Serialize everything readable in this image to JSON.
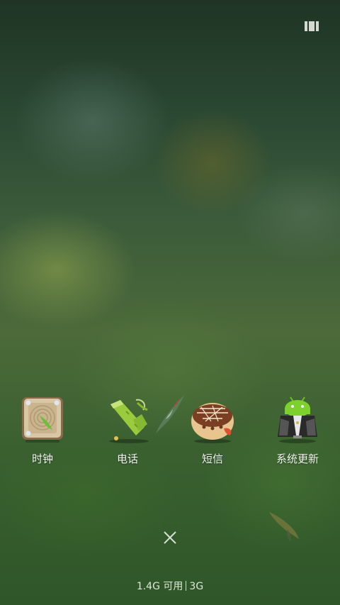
{
  "apps": [
    {
      "label": "时钟",
      "icon": "clock-icon"
    },
    {
      "label": "电话",
      "icon": "phone-icon"
    },
    {
      "label": "短信",
      "icon": "messages-icon"
    },
    {
      "label": "系统更新",
      "icon": "system-update-icon"
    }
  ],
  "memory": {
    "available": "1.4G 可用",
    "total": "3G"
  },
  "controls": {
    "recents_icon": "recent-tasks-icon",
    "close_icon": "close-icon"
  }
}
